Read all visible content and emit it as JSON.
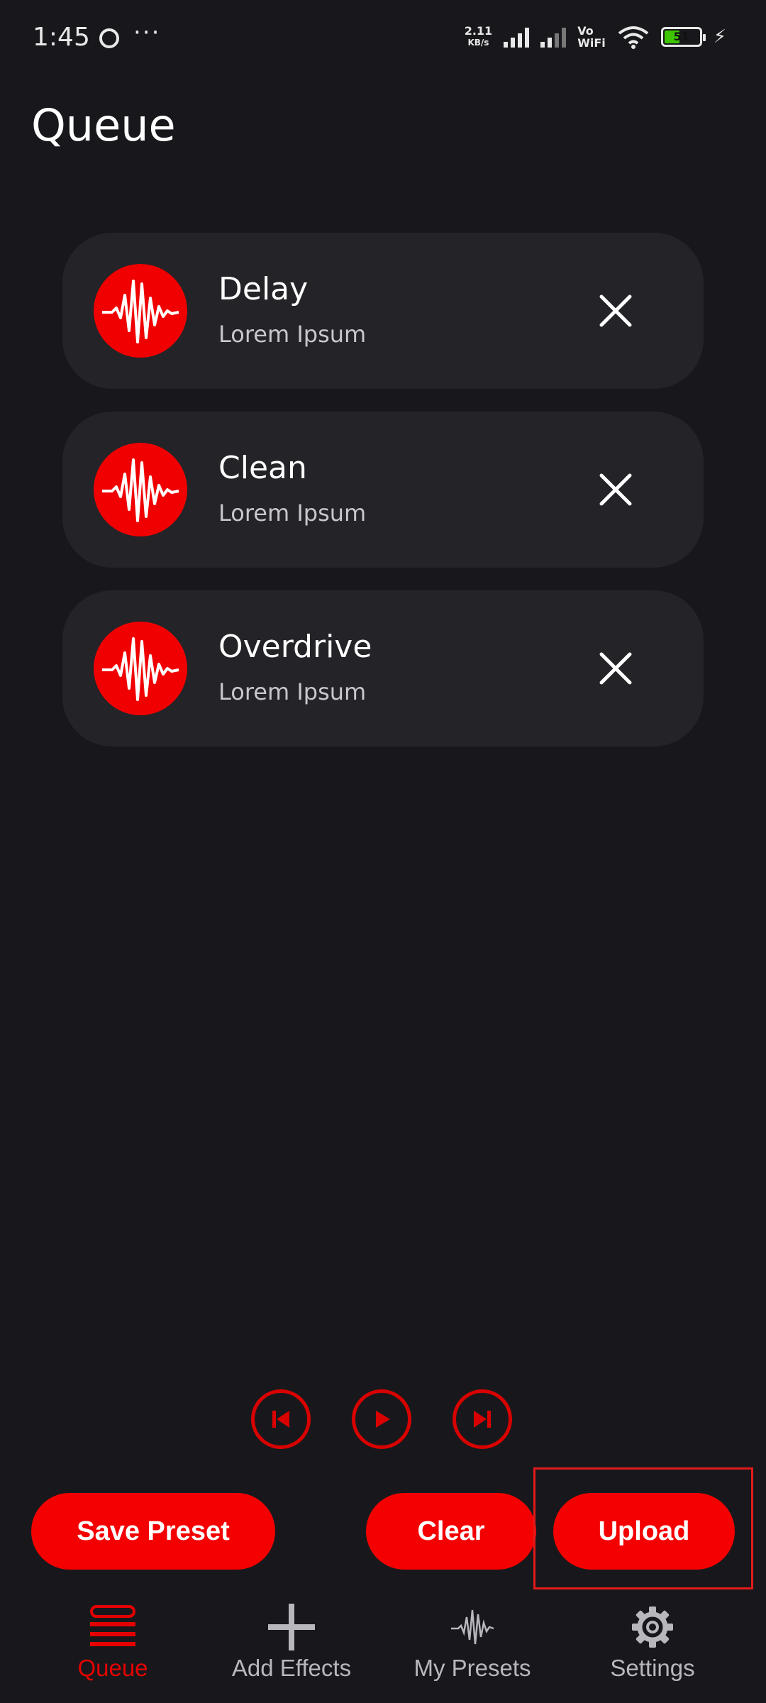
{
  "status_bar": {
    "time": "1:45",
    "dots": "···",
    "speed_value": "2.11",
    "speed_unit": "KB/s",
    "vowifi_top": "Vo",
    "vowifi_bottom": "WiFi",
    "battery_level": "51",
    "icons": [
      "dnd-icon",
      "signal-icon",
      "wifi-icon",
      "battery-icon",
      "charging-icon"
    ]
  },
  "page": {
    "title": "Queue"
  },
  "queue": [
    {
      "title": "Delay",
      "subtitle": "Lorem Ipsum"
    },
    {
      "title": "Clean",
      "subtitle": "Lorem Ipsum"
    },
    {
      "title": "Overdrive",
      "subtitle": "Lorem Ipsum"
    }
  ],
  "playback": {
    "icons": [
      "skip-previous-icon",
      "play-icon",
      "skip-next-icon"
    ]
  },
  "actions": {
    "save_preset": "Save Preset",
    "clear": "Clear",
    "upload": "Upload"
  },
  "nav": {
    "items": [
      {
        "label": "Queue",
        "icon": "queue-icon",
        "active": true
      },
      {
        "label": "Add Effects",
        "icon": "plus-icon",
        "active": false
      },
      {
        "label": "My Presets",
        "icon": "waveform-icon",
        "active": false
      },
      {
        "label": "Settings",
        "icon": "gear-icon",
        "active": false
      }
    ]
  },
  "colors": {
    "background": "#18181c",
    "card": "#232328",
    "accent": "#f40000",
    "nav_inactive": "#b8b8bc"
  }
}
